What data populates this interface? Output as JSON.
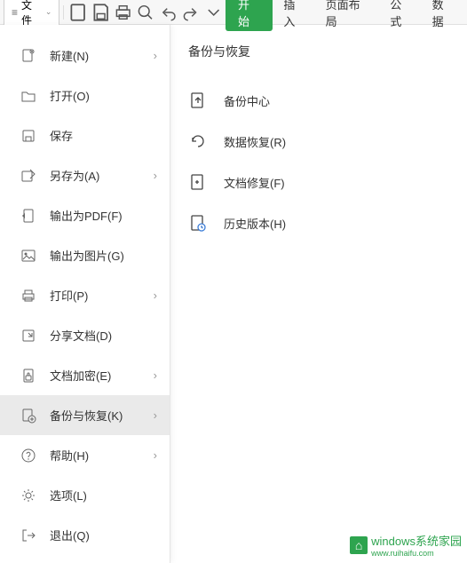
{
  "toolbar": {
    "file_label": "文件",
    "start_label": "开始",
    "tabs": [
      "插入",
      "页面布局",
      "公式",
      "数据"
    ]
  },
  "menu": {
    "items": [
      {
        "label": "新建(N)",
        "icon": "new",
        "arrow": true
      },
      {
        "label": "打开(O)",
        "icon": "open",
        "arrow": false
      },
      {
        "label": "保存",
        "icon": "save",
        "arrow": false
      },
      {
        "label": "另存为(A)",
        "icon": "saveas",
        "arrow": true
      },
      {
        "label": "输出为PDF(F)",
        "icon": "pdf",
        "arrow": false
      },
      {
        "label": "输出为图片(G)",
        "icon": "image",
        "arrow": false
      },
      {
        "label": "打印(P)",
        "icon": "print",
        "arrow": true
      },
      {
        "label": "分享文档(D)",
        "icon": "share",
        "arrow": false
      },
      {
        "label": "文档加密(E)",
        "icon": "encrypt",
        "arrow": true
      },
      {
        "label": "备份与恢复(K)",
        "icon": "backup",
        "arrow": true,
        "active": true
      },
      {
        "label": "帮助(H)",
        "icon": "help",
        "arrow": true
      },
      {
        "label": "选项(L)",
        "icon": "options",
        "arrow": false
      },
      {
        "label": "退出(Q)",
        "icon": "exit",
        "arrow": false
      }
    ]
  },
  "panel": {
    "title": "备份与恢复",
    "items": [
      {
        "label": "备份中心",
        "icon": "backup-center"
      },
      {
        "label": "数据恢复(R)",
        "icon": "data-recover"
      },
      {
        "label": "文档修复(F)",
        "icon": "doc-repair"
      },
      {
        "label": "历史版本(H)",
        "icon": "history"
      }
    ]
  },
  "watermark": {
    "brand": "windows系统家园",
    "url": "www.ruihaifu.com"
  }
}
